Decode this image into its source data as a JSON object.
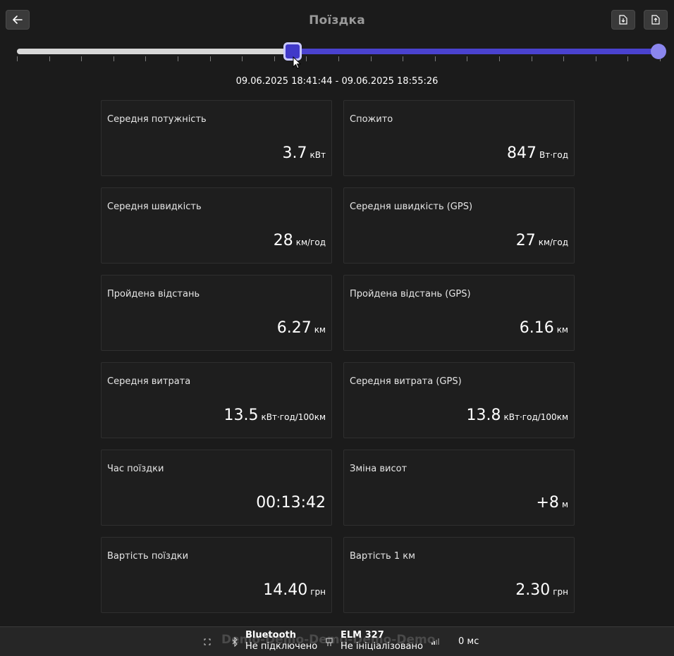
{
  "header": {
    "title": "Поїздка"
  },
  "icons": {
    "back": "arrow-left-icon",
    "export": "file-download-icon",
    "import": "file-upload-icon"
  },
  "colors": {
    "accent": "#4a42cf",
    "thumb_end": "#8b86ee",
    "track": "#d8d8d8",
    "background": "#1b1b1b"
  },
  "slider": {
    "start_fraction": 0.43,
    "end_fraction": 1.0
  },
  "time_range": "09.06.2025 18:41:44 - 09.06.2025 18:55:26",
  "cards": [
    {
      "label": "Середня потужність",
      "value": "3.7",
      "unit": "кВт"
    },
    {
      "label": "Спожито",
      "value": "847",
      "unit": "Вт·год"
    },
    {
      "label": "Середня швидкість",
      "value": "28",
      "unit": "км/год"
    },
    {
      "label": "Середня швидкість (GPS)",
      "value": "27",
      "unit": "км/год"
    },
    {
      "label": "Пройдена відстань",
      "value": "6.27",
      "unit": "км"
    },
    {
      "label": "Пройдена відстань (GPS)",
      "value": "6.16",
      "unit": "км"
    },
    {
      "label": "Середня витрата",
      "value": "13.5",
      "unit": "кВт·год/100км"
    },
    {
      "label": "Середня витрата (GPS)",
      "value": "13.8",
      "unit": "кВт·год/100км"
    },
    {
      "label": "Час поїздки",
      "value": "00:13:42",
      "unit": ""
    },
    {
      "label": "Зміна висот",
      "value": "+8",
      "unit": "м"
    },
    {
      "label": "Вартість поїздки",
      "value": "14.40",
      "unit": "грн"
    },
    {
      "label": "Вартість 1 км",
      "value": "2.30",
      "unit": "грн"
    }
  ],
  "status": {
    "watermark": "Demo-Demo-Demo-Demo-Demo",
    "bluetooth_title": "Bluetooth",
    "bluetooth_state": "Не підключено",
    "adapter_title": "ELM 327",
    "adapter_state": "Не ініціалізовано",
    "latency": "0 мс"
  }
}
